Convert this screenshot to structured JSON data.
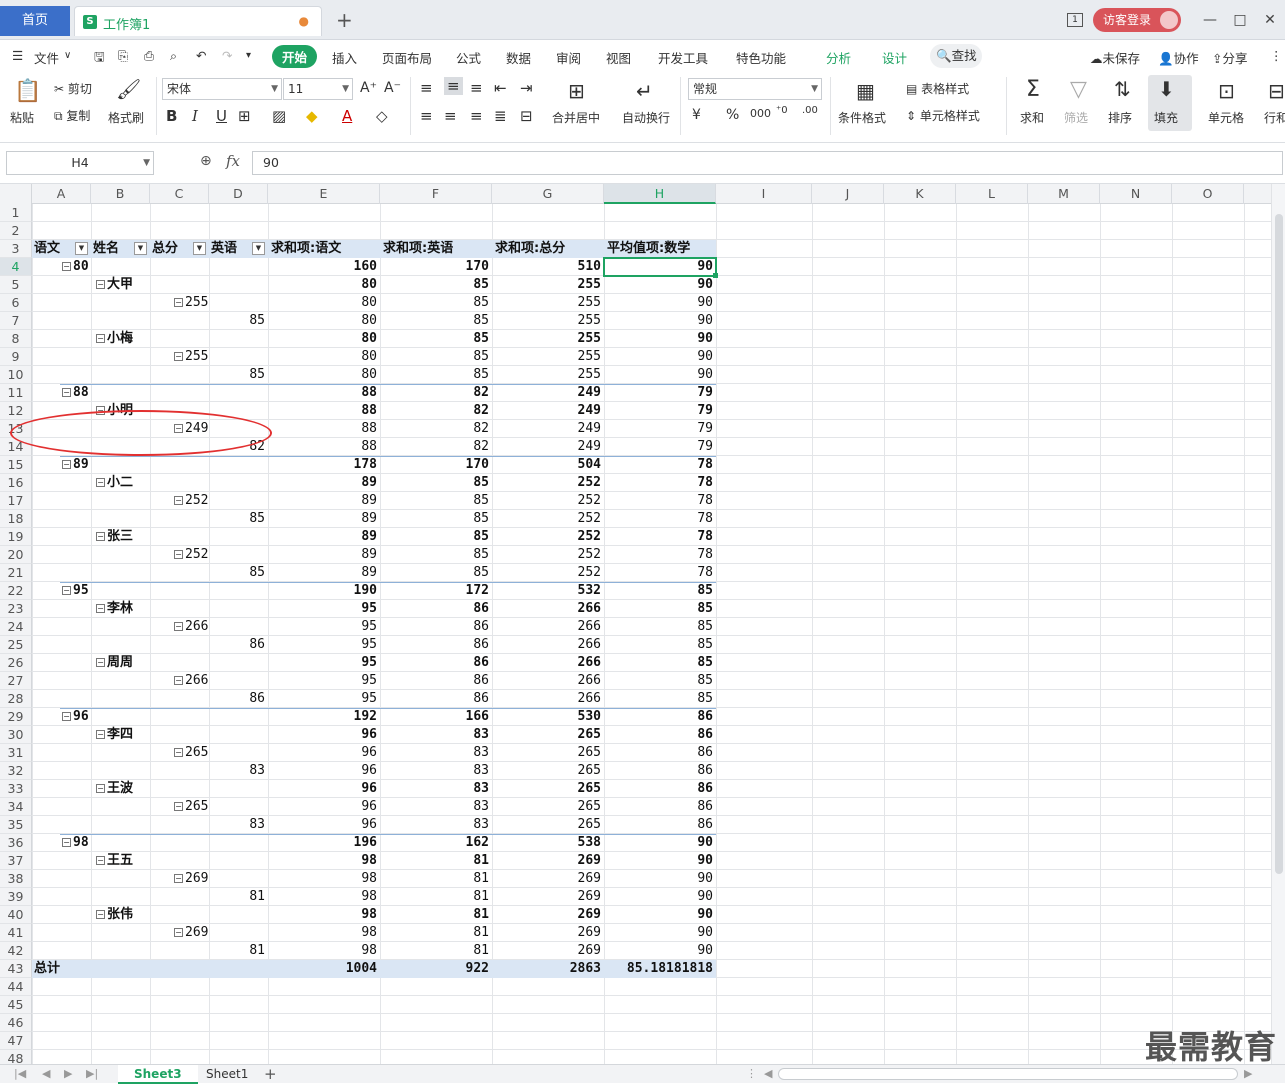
{
  "titlebar": {
    "home_tab": "首页",
    "workbook_tab": "工作簿1",
    "page_count": "1",
    "visitor_login": "访客登录"
  },
  "menu": {
    "file": "文件",
    "items": [
      "开始",
      "插入",
      "页面布局",
      "公式",
      "数据",
      "审阅",
      "视图",
      "开发工具",
      "特色功能",
      "分析",
      "设计"
    ],
    "search": "查找",
    "unsaved": "未保存",
    "collab": "协作",
    "share": "分享"
  },
  "ribbon": {
    "paste": "粘贴",
    "cut": "剪切",
    "copy": "复制",
    "format_painter": "格式刷",
    "font_name": "宋体",
    "font_size": "11",
    "merge_center": "合并居中",
    "wrap_text": "自动换行",
    "number_format": "常规",
    "cond_format": "条件格式",
    "table_style": "表格样式",
    "cell_style": "单元格样式",
    "sum": "求和",
    "filter": "筛选",
    "sort": "排序",
    "fill": "填充",
    "cell": "单元格",
    "row_col": "行和"
  },
  "formula_bar": {
    "name_box": "H4",
    "value": "90"
  },
  "columns": [
    "A",
    "B",
    "C",
    "D",
    "E",
    "F",
    "G",
    "H",
    "I",
    "J",
    "K",
    "L",
    "M",
    "N",
    "O"
  ],
  "rows": [
    "1",
    "2",
    "3",
    "4",
    "5",
    "6",
    "7",
    "8",
    "9",
    "10",
    "11",
    "12",
    "13",
    "14",
    "15",
    "16",
    "17",
    "18",
    "19",
    "20",
    "21",
    "22",
    "23",
    "24",
    "25",
    "26",
    "27",
    "28",
    "29",
    "30",
    "31",
    "32",
    "33",
    "34",
    "35",
    "36",
    "37",
    "38",
    "39",
    "40",
    "41",
    "42",
    "43",
    "44",
    "45",
    "46",
    "47",
    "48"
  ],
  "pivot": {
    "headers": [
      "语文",
      "姓名",
      "总分",
      "英语",
      "求和项:语文",
      "求和项:英语",
      "求和项:总分",
      "平均值项:数学"
    ],
    "body": [
      {
        "lvl": 0,
        "key": "80",
        "v": [
          "160",
          "170",
          "510",
          "90"
        ]
      },
      {
        "lvl": 1,
        "key": "大甲",
        "v": [
          "80",
          "85",
          "255",
          "90"
        ]
      },
      {
        "lvl": 2,
        "key": "255",
        "v": [
          "80",
          "85",
          "255",
          "90"
        ]
      },
      {
        "lvl": 3,
        "key": "85",
        "v": [
          "80",
          "85",
          "255",
          "90"
        ]
      },
      {
        "lvl": 1,
        "key": "小梅",
        "v": [
          "80",
          "85",
          "255",
          "90"
        ]
      },
      {
        "lvl": 2,
        "key": "255",
        "v": [
          "80",
          "85",
          "255",
          "90"
        ]
      },
      {
        "lvl": 3,
        "key": "85",
        "v": [
          "80",
          "85",
          "255",
          "90"
        ]
      },
      {
        "lvl": 0,
        "key": "88",
        "v": [
          "88",
          "82",
          "249",
          "79"
        ]
      },
      {
        "lvl": 1,
        "key": "小明",
        "v": [
          "88",
          "82",
          "249",
          "79"
        ]
      },
      {
        "lvl": 2,
        "key": "249",
        "v": [
          "88",
          "82",
          "249",
          "79"
        ]
      },
      {
        "lvl": 3,
        "key": "82",
        "v": [
          "88",
          "82",
          "249",
          "79"
        ]
      },
      {
        "lvl": 0,
        "key": "89",
        "v": [
          "178",
          "170",
          "504",
          "78"
        ]
      },
      {
        "lvl": 1,
        "key": "小二",
        "v": [
          "89",
          "85",
          "252",
          "78"
        ]
      },
      {
        "lvl": 2,
        "key": "252",
        "v": [
          "89",
          "85",
          "252",
          "78"
        ]
      },
      {
        "lvl": 3,
        "key": "85",
        "v": [
          "89",
          "85",
          "252",
          "78"
        ]
      },
      {
        "lvl": 1,
        "key": "张三",
        "v": [
          "89",
          "85",
          "252",
          "78"
        ]
      },
      {
        "lvl": 2,
        "key": "252",
        "v": [
          "89",
          "85",
          "252",
          "78"
        ]
      },
      {
        "lvl": 3,
        "key": "85",
        "v": [
          "89",
          "85",
          "252",
          "78"
        ]
      },
      {
        "lvl": 0,
        "key": "95",
        "v": [
          "190",
          "172",
          "532",
          "85"
        ]
      },
      {
        "lvl": 1,
        "key": "李林",
        "v": [
          "95",
          "86",
          "266",
          "85"
        ]
      },
      {
        "lvl": 2,
        "key": "266",
        "v": [
          "95",
          "86",
          "266",
          "85"
        ]
      },
      {
        "lvl": 3,
        "key": "86",
        "v": [
          "95",
          "86",
          "266",
          "85"
        ]
      },
      {
        "lvl": 1,
        "key": "周周",
        "v": [
          "95",
          "86",
          "266",
          "85"
        ]
      },
      {
        "lvl": 2,
        "key": "266",
        "v": [
          "95",
          "86",
          "266",
          "85"
        ]
      },
      {
        "lvl": 3,
        "key": "86",
        "v": [
          "95",
          "86",
          "266",
          "85"
        ]
      },
      {
        "lvl": 0,
        "key": "96",
        "v": [
          "192",
          "166",
          "530",
          "86"
        ]
      },
      {
        "lvl": 1,
        "key": "李四",
        "v": [
          "96",
          "83",
          "265",
          "86"
        ]
      },
      {
        "lvl": 2,
        "key": "265",
        "v": [
          "96",
          "83",
          "265",
          "86"
        ]
      },
      {
        "lvl": 3,
        "key": "83",
        "v": [
          "96",
          "83",
          "265",
          "86"
        ]
      },
      {
        "lvl": 1,
        "key": "王波",
        "v": [
          "96",
          "83",
          "265",
          "86"
        ]
      },
      {
        "lvl": 2,
        "key": "265",
        "v": [
          "96",
          "83",
          "265",
          "86"
        ]
      },
      {
        "lvl": 3,
        "key": "83",
        "v": [
          "96",
          "83",
          "265",
          "86"
        ]
      },
      {
        "lvl": 0,
        "key": "98",
        "v": [
          "196",
          "162",
          "538",
          "90"
        ]
      },
      {
        "lvl": 1,
        "key": "王五",
        "v": [
          "98",
          "81",
          "269",
          "90"
        ]
      },
      {
        "lvl": 2,
        "key": "269",
        "v": [
          "98",
          "81",
          "269",
          "90"
        ]
      },
      {
        "lvl": 3,
        "key": "81",
        "v": [
          "98",
          "81",
          "269",
          "90"
        ]
      },
      {
        "lvl": 1,
        "key": "张伟",
        "v": [
          "98",
          "81",
          "269",
          "90"
        ]
      },
      {
        "lvl": 2,
        "key": "269",
        "v": [
          "98",
          "81",
          "269",
          "90"
        ]
      },
      {
        "lvl": 3,
        "key": "81",
        "v": [
          "98",
          "81",
          "269",
          "90"
        ]
      }
    ],
    "total": {
      "label": "总计",
      "v": [
        "1004",
        "922",
        "2863",
        "85.18181818"
      ]
    }
  },
  "sheets": [
    "Sheet3",
    "Sheet1"
  ],
  "watermark": "最需教育",
  "colors": {
    "accent": "#1ea362",
    "pivot_band": "#dae6f4",
    "highlight": "#e23030",
    "home_tab": "#3b6fc9"
  }
}
